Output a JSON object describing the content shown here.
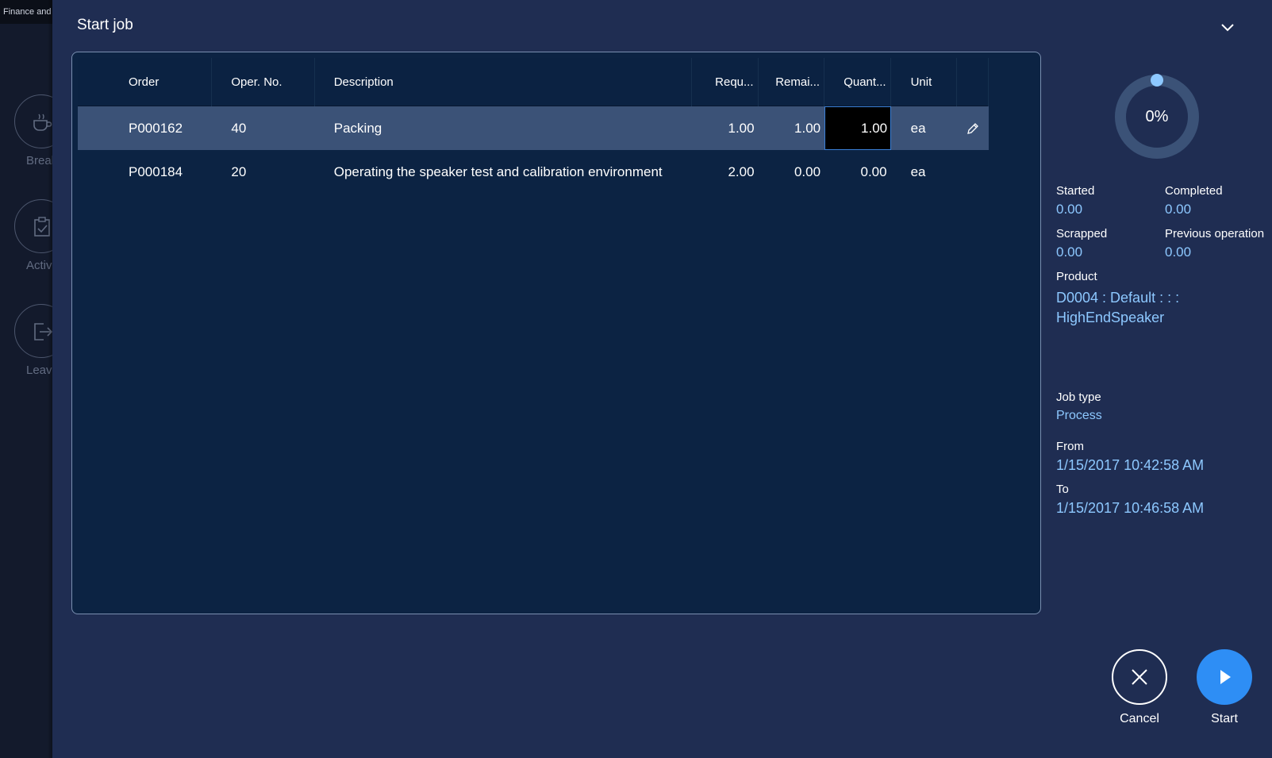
{
  "background": {
    "app_title": "Finance and",
    "side_labels": [
      "Break",
      "Activities",
      "Leaving"
    ]
  },
  "dialog": {
    "title": "Start job"
  },
  "grid": {
    "headers": {
      "order": "Order",
      "oper_no": "Oper. No.",
      "description": "Description",
      "required": "Requ...",
      "remaining": "Remai...",
      "quantity": "Quant...",
      "unit": "Unit"
    },
    "rows": [
      {
        "order": "P000162",
        "oper_no": "40",
        "description": "Packing",
        "required": "1.00",
        "remaining": "1.00",
        "quantity": "1.00",
        "unit": "ea",
        "selected": true
      },
      {
        "order": "P000184",
        "oper_no": "20",
        "description": "Operating the speaker test and calibration environment",
        "required": "2.00",
        "remaining": "0.00",
        "quantity": "0.00",
        "unit": "ea",
        "selected": false
      }
    ]
  },
  "info": {
    "progress": {
      "percent": 0,
      "label": "0%"
    },
    "started_label": "Started",
    "started_value": "0.00",
    "completed_label": "Completed",
    "completed_value": "0.00",
    "scrapped_label": "Scrapped",
    "scrapped_value": "0.00",
    "previous_label": "Previous operation",
    "previous_value": "0.00",
    "product_label": "Product",
    "product_line1": "D0004 : Default :  :  :",
    "product_line2": "HighEndSpeaker",
    "job_type_label": "Job type",
    "job_type_value": "Process",
    "from_label": "From",
    "from_value": "1/15/2017 10:42:58 AM",
    "to_label": "To",
    "to_value": "1/15/2017 10:46:58 AM"
  },
  "actions": {
    "cancel_label": "Cancel",
    "start_label": "Start"
  },
  "colors": {
    "accent_blue": "#2e8ef5",
    "value_text": "#8dc8ff",
    "selected_row": "#3b5277",
    "panel_bg": "#0c2343",
    "dialog_bg": "#1f2d52"
  }
}
